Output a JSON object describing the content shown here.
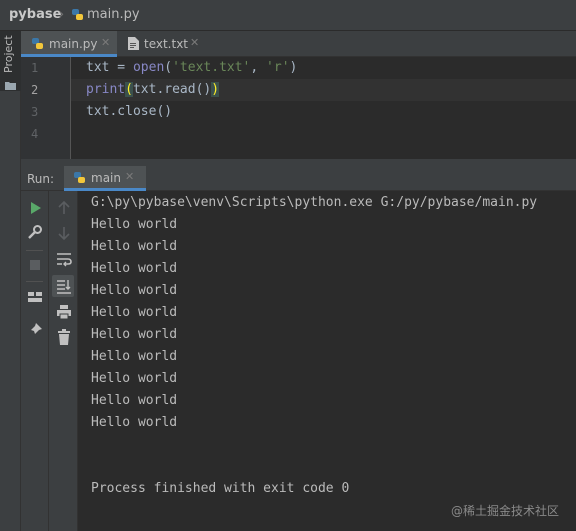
{
  "breadcrumb": {
    "project": "pybase",
    "file": "main.py"
  },
  "sidebar": {
    "project_label": "Project"
  },
  "editor_tabs": [
    {
      "label": "main.py",
      "icon": "python-file-icon",
      "active": true
    },
    {
      "label": "text.txt",
      "icon": "text-file-icon",
      "active": false
    }
  ],
  "editor": {
    "line_numbers": [
      "1",
      "2",
      "3",
      "4"
    ],
    "current_line": 2,
    "code": {
      "l1_var": "txt = ",
      "l1_fn": "open",
      "l1_open": "(",
      "l1_arg1": "'text.txt'",
      "l1_comma": ", ",
      "l1_arg2": "'r'",
      "l1_close": ")",
      "l2_fn": "print",
      "l2_open": "(",
      "l2_mid": "txt.read()",
      "l2_close": ")",
      "l3": "txt.close()"
    }
  },
  "run": {
    "label": "Run:",
    "tab_label": "main",
    "command": "G:\\py\\pybase\\venv\\Scripts\\python.exe G:/py/pybase/main.py",
    "output": [
      "Hello world",
      "Hello world",
      "Hello world",
      "Hello world",
      "Hello world",
      "Hello world",
      "Hello world",
      "Hello world",
      "Hello world",
      "Hello world"
    ],
    "exit_message": "Process finished with exit code 0"
  },
  "toolbar_icons": [
    "run-icon",
    "wrench-icon",
    "stop-icon",
    "layout-icon",
    "pin-icon",
    "up-arrow-icon",
    "down-arrow-icon",
    "soft-wrap-icon",
    "scroll-to-end-icon",
    "print-icon",
    "trash-icon"
  ],
  "colors": {
    "accent": "#4a88c7",
    "run_green": "#59a869",
    "editor_bg": "#2b2b2b",
    "panel_bg": "#3c3f41"
  },
  "watermark": "@稀土掘金技术社区"
}
